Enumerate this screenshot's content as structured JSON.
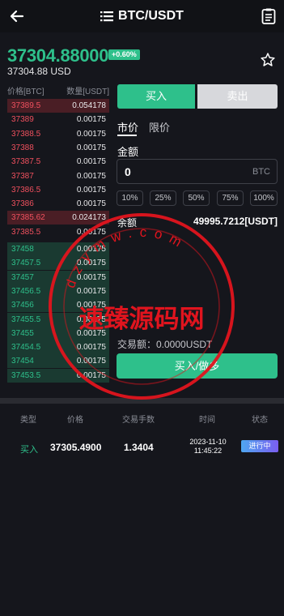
{
  "header": {
    "title": "BTC/USDT"
  },
  "ticker": {
    "price": "37304.88000",
    "change": "+0.60%",
    "price_usd": "37304.88 USD"
  },
  "orderbook": {
    "col_price": "价格[BTC]",
    "col_qty": "数量[USDT]",
    "asks": [
      {
        "price": "37389.5",
        "qty": "0.054178",
        "depth": 1.0
      },
      {
        "price": "37389",
        "qty": "0.00175",
        "depth": 0.0
      },
      {
        "price": "37388.5",
        "qty": "0.00175",
        "depth": 0.0
      },
      {
        "price": "37388",
        "qty": "0.00175",
        "depth": 0.0
      },
      {
        "price": "37387.5",
        "qty": "0.00175",
        "depth": 0.0
      },
      {
        "price": "37387",
        "qty": "0.00175",
        "depth": 0.0
      },
      {
        "price": "37386.5",
        "qty": "0.00175",
        "depth": 0.0
      },
      {
        "price": "37386",
        "qty": "0.00175",
        "depth": 0.0
      },
      {
        "price": "37385.62",
        "qty": "0.024173",
        "depth": 1.0
      },
      {
        "price": "37385.5",
        "qty": "0.00175",
        "depth": 0.0
      }
    ],
    "bids": [
      {
        "price": "37458",
        "qty": "0.00175",
        "depth": 1.0
      },
      {
        "price": "37457.5",
        "qty": "0.00175",
        "depth": 1.0
      },
      {
        "price": "37457",
        "qty": "0.00175",
        "depth": 1.0
      },
      {
        "price": "37456.5",
        "qty": "0.00175",
        "depth": 1.0
      },
      {
        "price": "37456",
        "qty": "0.00175",
        "depth": 1.0
      },
      {
        "price": "37455.5",
        "qty": "0.00175",
        "depth": 1.0
      },
      {
        "price": "37455",
        "qty": "0.00175",
        "depth": 1.0
      },
      {
        "price": "37454.5",
        "qty": "0.00175",
        "depth": 1.0
      },
      {
        "price": "37454",
        "qty": "0.00175",
        "depth": 1.0
      },
      {
        "price": "37453.5",
        "qty": "0.00175",
        "depth": 1.0
      }
    ]
  },
  "trade": {
    "tab_buy": "买入",
    "tab_sell": "卖出",
    "order_market": "市价",
    "order_limit": "限价",
    "amount_label": "金额",
    "amount_value": "0",
    "amount_unit": "BTC",
    "percents": [
      "10%",
      "25%",
      "50%",
      "75%",
      "100%"
    ],
    "balance_label": "余额",
    "balance_value": "49995.7212[USDT]",
    "trade_amount": "交易额：0.0000USDT",
    "buy_button": "买入/做多"
  },
  "history": {
    "headers": {
      "type": "类型",
      "price": "价格",
      "fee": "交易手数",
      "time": "时间",
      "status": "状态"
    },
    "row": {
      "type": "买入",
      "price": "37305.4900",
      "fee": "1.3404",
      "date": "2023-11-10",
      "clock": "11:45:22",
      "status": "进行中"
    }
  },
  "watermark": {
    "text": "速臻源码网",
    "url": "dzymw.com"
  },
  "colors": {
    "up": "#2ec08b",
    "down": "#f0505e",
    "bg": "#15161c",
    "badge_start": "#4fa7f0",
    "badge_end": "#7a5ef0"
  }
}
